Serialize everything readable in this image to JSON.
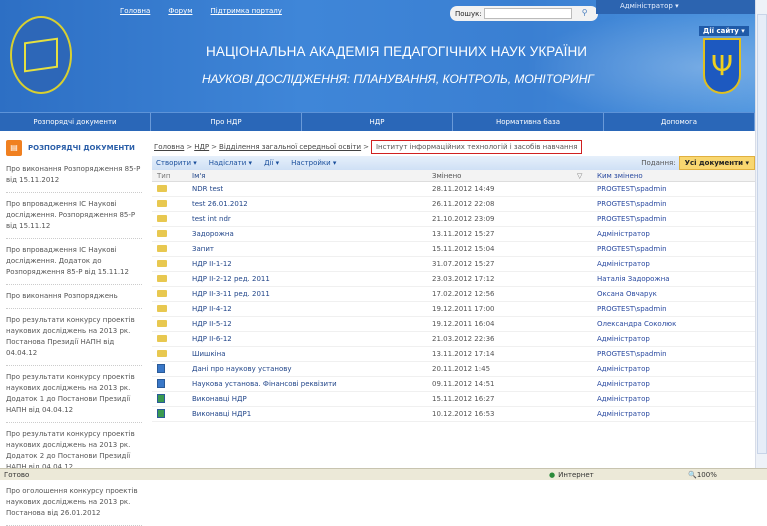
{
  "header": {
    "links": [
      "Головна",
      "Форум",
      "Підтримка порталу"
    ],
    "search_label": "Пошук:",
    "search_value": "",
    "user": "Адміністратор",
    "title": "НАЦІОНАЛЬНА АКАДЕМІЯ ПЕДАГОГІЧНИХ НАУК УКРАЇНИ",
    "subtitle": "НАУКОВІ ДОСЛІДЖЕННЯ: ПЛАНУВАННЯ, КОНТРОЛЬ, МОНІТОРИНГ",
    "site_actions": "Дії сайту ▾"
  },
  "nav": [
    "Розпорядчі документи",
    "Про НДР",
    "НДР",
    "Нормативна база",
    "Допомога"
  ],
  "sidebar": {
    "title": "РОЗПОРЯДЧІ ДОКУМЕНТИ",
    "items": [
      "Про виконання Розпорядження 85-Р від 15.11.2012",
      "Про впровадження ІС Наукові дослідження. Розпорядження 85-Р від 15.11.12",
      "Про впровадження ІС Наукові дослідження. Додаток до Розпорядження 85-Р від 15.11.12",
      "Про виконання Розпоряджень",
      "Про результати конкурсу проектів наукових досліджень на 2013 рк. Постанова Президії НАПН від 04.04.12",
      "Про результати конкурсу проектів наукових досліджень на 2013 рк. Додаток 1 до Постанови Президії НАПН від 04.04.12",
      "Про результати конкурсу проектів наукових досліджень на 2013 рк. Додаток 2 до Постанови Президії НАПН від 04.04.12",
      "Про оголошення конкурсу проектів наукових досліджень на 2013 рк. Постанова від 26.01.2012"
    ]
  },
  "breadcrumb": {
    "items": [
      "Головна",
      "НДР",
      "Відділення загальної середньої освіти"
    ],
    "current": "Інститут інформаційних технологій і засобів навчання"
  },
  "toolbar": {
    "create": "Створити ▾",
    "upload": "Надіслати ▾",
    "actions": "Дії ▾",
    "settings": "Настройки ▾",
    "view_label": "Подання:",
    "view_value": "Усі документи ▾"
  },
  "columns": [
    "Тип",
    "Ім'я",
    "Змінено",
    "Ким змінено"
  ],
  "rows": [
    {
      "type": "folder",
      "name": "NDR test",
      "modified": "28.11.2012 14:49",
      "by": "PROGTEST\\spadmin"
    },
    {
      "type": "folder",
      "name": "test 26.01.2012",
      "modified": "26.11.2012 22:08",
      "by": "PROGTEST\\spadmin"
    },
    {
      "type": "folder",
      "name": "test int ndr",
      "modified": "21.10.2012 23:09",
      "by": "PROGTEST\\spadmin"
    },
    {
      "type": "folder",
      "name": "Задорожна",
      "modified": "13.11.2012 15:27",
      "by": "Адміністратор"
    },
    {
      "type": "folder",
      "name": "Запит",
      "modified": "15.11.2012 15:04",
      "by": "PROGTEST\\spadmin"
    },
    {
      "type": "folder",
      "name": "НДР ІІ-1-12",
      "modified": "31.07.2012 15:27",
      "by": "Адміністратор"
    },
    {
      "type": "folder",
      "name": "НДР ІІ-2-12 ред. 2011",
      "modified": "23.03.2012 17:12",
      "by": "Наталія Задорожна"
    },
    {
      "type": "folder",
      "name": "НДР ІІ-3-11 ред. 2011",
      "modified": "17.02.2012 12:56",
      "by": "Оксана Овчарук"
    },
    {
      "type": "folder",
      "name": "НДР ІІ-4-12",
      "modified": "19.12.2011 17:00",
      "by": "PROGTEST\\spadmin"
    },
    {
      "type": "folder",
      "name": "НДР ІІ-5-12",
      "modified": "19.12.2011 16:04",
      "by": "Олександра Соколюк"
    },
    {
      "type": "folder",
      "name": "НДР ІІ-6-12",
      "modified": "21.03.2012 22:36",
      "by": "Адміністратор"
    },
    {
      "type": "folder",
      "name": "Шишкіна",
      "modified": "13.11.2012 17:14",
      "by": "PROGTEST\\spadmin"
    },
    {
      "type": "doc",
      "name": "Дані про наукову установу",
      "modified": "20.11.2012 1:45",
      "by": "Адміністратор"
    },
    {
      "type": "doc",
      "name": "Наукова установа. Фінансові реквізити",
      "modified": "09.11.2012 14:51",
      "by": "Адміністратор"
    },
    {
      "type": "doc-green",
      "name": "Виконавці НДР",
      "modified": "15.11.2012 16:27",
      "by": "Адміністратор"
    },
    {
      "type": "doc-green",
      "name": "Виконавці НДР1",
      "modified": "10.12.2012 16:53",
      "by": "Адміністратор"
    }
  ],
  "status": {
    "left": "Готово",
    "zone": "Интернет",
    "zoom": "100%"
  }
}
